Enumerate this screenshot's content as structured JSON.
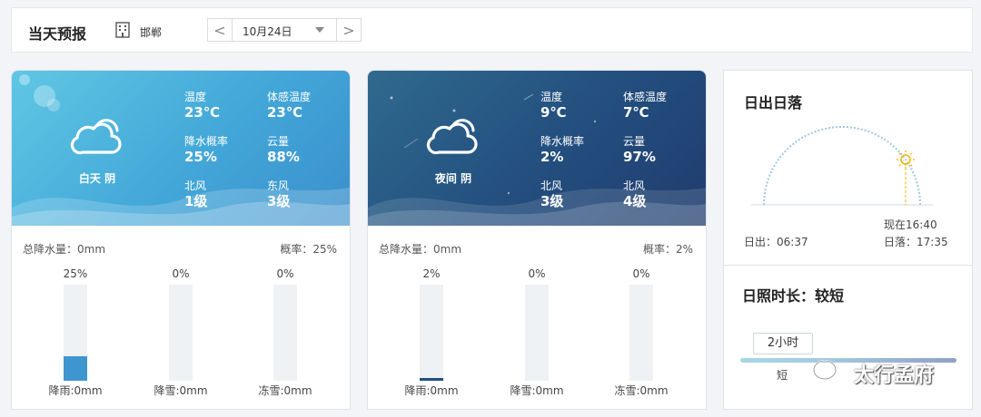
{
  "header": {
    "title": "当天预报",
    "city": "邯郸",
    "date": "10月24日",
    "prev_glyph": "<",
    "next_glyph": ">"
  },
  "day": {
    "period": "白天 阴",
    "icon": "cloud-icon",
    "stats": [
      {
        "label": "温度",
        "value": "23℃"
      },
      {
        "label": "体感温度",
        "value": "23℃"
      },
      {
        "label": "降水概率",
        "value": "25%"
      },
      {
        "label": "云量",
        "value": "88%"
      },
      {
        "label": "北风",
        "value": "1级"
      },
      {
        "label": "东风",
        "value": "3级"
      }
    ],
    "total_precip": "总降水量：0mm",
    "probability": "概率：25%",
    "bars": [
      {
        "pct": "25%",
        "name": "降雨:0mm",
        "level": 0.25
      },
      {
        "pct": "0%",
        "name": "降雪:0mm",
        "level": 0
      },
      {
        "pct": "0%",
        "name": "冻雪:0mm",
        "level": 0
      }
    ]
  },
  "night": {
    "period": "夜间 阴",
    "icon": "cloud-icon",
    "stats": [
      {
        "label": "温度",
        "value": "9℃"
      },
      {
        "label": "体感温度",
        "value": "7℃"
      },
      {
        "label": "降水概率",
        "value": "2%"
      },
      {
        "label": "云量",
        "value": "97%"
      },
      {
        "label": "北风",
        "value": "3级"
      },
      {
        "label": "北风",
        "value": "4级"
      }
    ],
    "total_precip": "总降水量：0mm",
    "probability": "概率：2%",
    "bars": [
      {
        "pct": "2%",
        "name": "降雨:0mm",
        "level": 0.02
      },
      {
        "pct": "0%",
        "name": "降雪:0mm",
        "level": 0
      },
      {
        "pct": "0%",
        "name": "冻雪:0mm",
        "level": 0
      }
    ]
  },
  "sun": {
    "title": "日出日落",
    "now": "现在16:40",
    "sunrise": "日出：06:37",
    "sunset": "日落：17:35"
  },
  "duration": {
    "title": "日照时长：较短",
    "value": "2小时",
    "label": "短"
  },
  "watermark": {
    "text": "太行孟府"
  },
  "colors": {
    "day_banner": "#43a7d8",
    "night_banner": "#234e7e",
    "bar_fill": "#3e95cf",
    "night_bar_fill": "#234e7e",
    "sun": "#f4b400"
  }
}
